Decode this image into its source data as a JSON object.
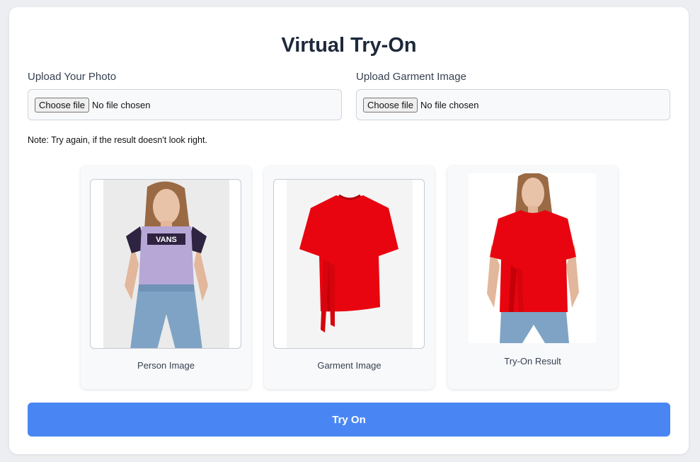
{
  "header": {
    "title": "Virtual Try-On"
  },
  "uploads": [
    {
      "label": "Upload Your Photo",
      "button": "Choose file",
      "status": "No file chosen"
    },
    {
      "label": "Upload Garment Image",
      "button": "Choose file",
      "status": "No file chosen"
    }
  ],
  "note": "Note: Try again, if the result doesn't look right.",
  "panels": {
    "person": {
      "caption": "Person Image",
      "shirt_text": "VANS"
    },
    "garment": {
      "caption": "Garment Image"
    },
    "result": {
      "caption": "Try-On Result"
    }
  },
  "action": {
    "label": "Try On"
  },
  "colors": {
    "accent": "#4a86f3",
    "garment_red": "#e8050f",
    "tee_lavender": "#b7a7d6"
  },
  "icons": [
    "person-photo",
    "garment-photo",
    "tryon-result-photo"
  ]
}
